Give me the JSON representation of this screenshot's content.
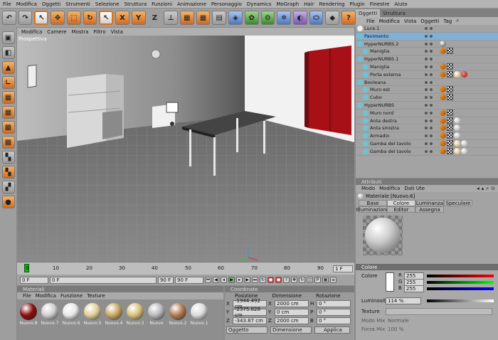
{
  "menubar": {
    "items": [
      "File",
      "Modifica",
      "Oggetti",
      "Strumenti",
      "Selezione",
      "Struttura",
      "Funzioni",
      "Animazione",
      "Personaggio",
      "Dynamics",
      "MoGraph",
      "Hair",
      "Rendering",
      "Plugin",
      "Finestre",
      "Aiuto"
    ]
  },
  "toolbar": {
    "icons": [
      "undo-icon",
      "redo-icon",
      "live-select-icon",
      "move-icon",
      "scale-icon",
      "rotate-icon",
      "select-icon",
      "x-axis-icon",
      "y-axis-icon",
      "z-axis-icon",
      "coordinate-system-icon",
      "render-view-icon",
      "render-picture-viewer-icon",
      "render-settings-icon",
      "cube-icon",
      "nurbs-icon",
      "array-icon",
      "deformer-icon",
      "scene-icon",
      "light-icon",
      "camera-icon",
      "help-icon"
    ],
    "axis_labels": [
      "X",
      "Y",
      "Z"
    ],
    "help_label": "?"
  },
  "viewport": {
    "menu": [
      "Modifica",
      "Camere",
      "Mostra",
      "Filtro",
      "Vista"
    ],
    "label": "Prospettiva"
  },
  "timeline": {
    "ticks": [
      "0",
      "10",
      "20",
      "30",
      "40",
      "50",
      "60",
      "70",
      "80",
      "90"
    ],
    "current_frame": "1 F"
  },
  "transport": {
    "start": "0 F",
    "current": "0 F",
    "end_a": "90 F",
    "end_b": "90 F"
  },
  "materials": {
    "title": "Materiali",
    "menu": [
      "File",
      "Modifica",
      "Funzione",
      "Texture"
    ],
    "items": [
      {
        "name": "Nuovo.8",
        "color": "#8a0d0d"
      },
      {
        "name": "Nuovo.7",
        "color": "#cfcfcf"
      },
      {
        "name": "Nuovo.6",
        "color": "#e8e8e8"
      },
      {
        "name": "Nuovo.5",
        "color": "#e0cf9a"
      },
      {
        "name": "Nuovo.4",
        "color": "#c8a862"
      },
      {
        "name": "Nuovo.3",
        "color": "#d9c07a"
      },
      {
        "name": "Nuovo",
        "color": "#b8b8b8"
      },
      {
        "name": "Nuovo.2",
        "color": "#b07a50"
      },
      {
        "name": "Nuovo.1",
        "color": "#dcdcdc"
      }
    ]
  },
  "coords": {
    "title": "Coordinate",
    "headers": [
      "Posizione",
      "Dimensione",
      "Rotazione"
    ],
    "rows": [
      {
        "axis": "X",
        "pos": "-1944.492 cm",
        "size_axis": "X",
        "size": "2000 cm",
        "rot_axis": "H",
        "rot": "0 °"
      },
      {
        "axis": "Y",
        "pos": "-2375.828 cm",
        "size_axis": "Y",
        "size": "0 cm",
        "rot_axis": "P",
        "rot": "0 °"
      },
      {
        "axis": "Z",
        "pos": "-343.87 cm",
        "size_axis": "Z",
        "size": "2000 cm",
        "rot_axis": "B",
        "rot": "0 °"
      }
    ],
    "mode1": "Oggetto",
    "mode2": "Dimensione",
    "apply": "Applica"
  },
  "objects": {
    "tabs": [
      "Oggetti",
      "Struttura"
    ],
    "menu": [
      "File",
      "Modifica",
      "Vista",
      "Oggetti",
      "Tag"
    ],
    "rows": [
      {
        "name": "Luce.1",
        "indent": 0,
        "icon": "light-icon",
        "tags": []
      },
      {
        "name": "Pavimento",
        "indent": 0,
        "icon": "floor-icon",
        "tags": [],
        "selected": true
      },
      {
        "name": "HyperNURBS.2",
        "indent": 0,
        "icon": "hypernurbs-icon",
        "tags": [
          "sphere"
        ]
      },
      {
        "name": "Maniglia",
        "indent": 1,
        "icon": "object-icon",
        "tags": [
          "phong",
          "checker"
        ]
      },
      {
        "name": "HyperNURBS.1",
        "indent": 0,
        "icon": "hypernurbs-icon",
        "tags": []
      },
      {
        "name": "Maniglia",
        "indent": 1,
        "icon": "object-icon",
        "tags": [
          "phong",
          "checker"
        ]
      },
      {
        "name": "Porta esterna",
        "indent": 1,
        "icon": "object-icon",
        "tags": [
          "phong",
          "checker",
          "gold",
          "red"
        ]
      },
      {
        "name": "Booleana",
        "indent": 0,
        "icon": "boolean-icon",
        "tags": []
      },
      {
        "name": "Muro est",
        "indent": 1,
        "icon": "object-icon",
        "tags": [
          "phong",
          "checker"
        ]
      },
      {
        "name": "Cubo",
        "indent": 1,
        "icon": "object-icon",
        "tags": [
          "phong",
          "checker"
        ]
      },
      {
        "name": "HyperNURBS",
        "indent": 0,
        "icon": "hypernurbs-icon",
        "tags": []
      },
      {
        "name": "Muro nord",
        "indent": 1,
        "icon": "object-icon",
        "tags": [
          "phong",
          "checker"
        ]
      },
      {
        "name": "Anta destra",
        "indent": 1,
        "icon": "object-icon",
        "tags": [
          "phong",
          "checker",
          "white"
        ]
      },
      {
        "name": "Anta sinistra",
        "indent": 1,
        "icon": "object-icon",
        "tags": [
          "phong",
          "checker",
          "white"
        ]
      },
      {
        "name": "Armadio",
        "indent": 1,
        "icon": "object-icon",
        "tags": [
          "phong",
          "checker",
          "white"
        ]
      },
      {
        "name": "Gamba del tavolo",
        "indent": 1,
        "icon": "object-icon",
        "tags": [
          "phong",
          "checker",
          "gold",
          "white"
        ]
      },
      {
        "name": "Gamba del tavolo",
        "indent": 1,
        "icon": "object-icon",
        "tags": [
          "phong",
          "checker",
          "gold",
          "white"
        ]
      }
    ]
  },
  "attributes": {
    "title": "Attributi",
    "menu": [
      "Modo",
      "Modifica",
      "Dati Ute"
    ],
    "material_name": "Materiale [Nuovo.6]",
    "tabs_row1": [
      "Base",
      "Colore",
      "Luminanza",
      "Speculare"
    ],
    "tabs_row2": [
      "Illuminazione",
      "Editor",
      "Assegna"
    ],
    "active_tab": "Colore"
  },
  "color": {
    "title": "Colore",
    "color_label": "Colore",
    "channels": [
      {
        "label": "R",
        "value": "255"
      },
      {
        "label": "G",
        "value": "255"
      },
      {
        "label": "B",
        "value": "255"
      }
    ],
    "brightness_label": "Luminosità",
    "brightness": "114 %",
    "texture_label": "Texture",
    "mix_mode_label": "Modo Mix",
    "mix_mode": "Normale",
    "mix_strength_label": "Forza Mix",
    "mix_strength": "100 %"
  }
}
